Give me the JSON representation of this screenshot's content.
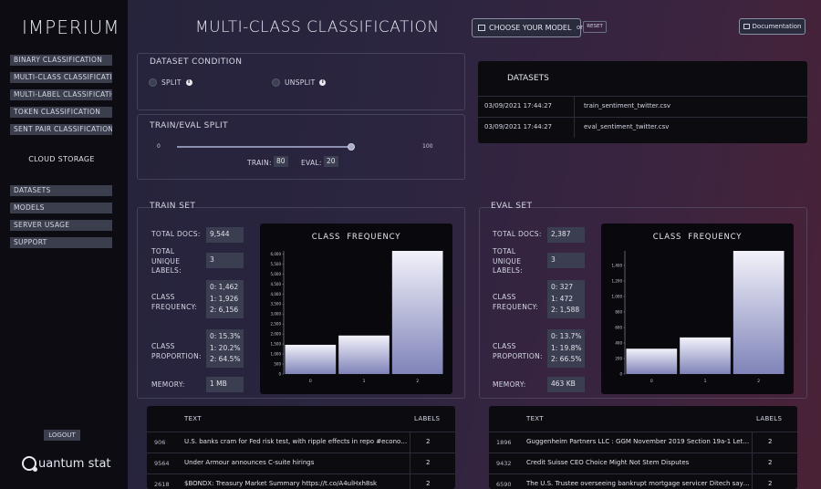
{
  "sidebar": {
    "brand": "IMPERIUM",
    "tasks": [
      "BINARY CLASSIFICATION",
      "MULTI-CLASS CLASSIFICATION",
      "MULTI-LABEL CLASSIFICATION",
      "TOKEN CLASSIFICATION",
      "SENT PAIR CLASSIFICATION"
    ],
    "cloud_storage": "CLOUD STORAGE",
    "storage_items": [
      "DATASETS",
      "MODELS",
      "SERVER USAGE",
      "SUPPORT"
    ],
    "logout": "LOGOUT",
    "logo_text": "uantum stat"
  },
  "header": {
    "title": "MULTI-CLASS CLASSIFICATION",
    "choose_model": "CHOOSE YOUR MODEL",
    "or": "or",
    "reset": "RESET",
    "documentation": "Documentation"
  },
  "dataset_condition": {
    "title": "DATASET CONDITION",
    "split": "SPLIT",
    "unsplit": "UNSPLIT"
  },
  "train_eval_split": {
    "title": "TRAIN/EVAL SPLIT",
    "min": "0",
    "max": "100",
    "value": 80,
    "train_label": "TRAIN:",
    "train_value": "80",
    "eval_label": "EVAL:",
    "eval_value": "20"
  },
  "datasets": {
    "title": "DATASETS",
    "rows": [
      {
        "date": "03/09/2021 17:44:27",
        "file": "train_sentiment_twitter.csv"
      },
      {
        "date": "03/09/2021 17:44:27",
        "file": "eval_sentiment_twitter.csv"
      }
    ]
  },
  "train_set": {
    "title": "TRAIN SET",
    "total_docs_label": "TOTAL DOCS:",
    "total_docs": "9,544",
    "unique_labels_label": [
      "TOTAL",
      "UNIQUE",
      "LABELS:"
    ],
    "unique_labels": "3",
    "class_freq_label": [
      "CLASS",
      "FREQUENCY:"
    ],
    "class_freq": [
      "0:  1,462",
      "1:  1,926",
      "2:  6,156"
    ],
    "class_prop_label": [
      "CLASS",
      "PROPORTION:"
    ],
    "class_prop": [
      "0:  15.3%",
      "1:  20.2%",
      "2:  64.5%"
    ],
    "memory_label": "MEMORY:",
    "memory": "1 MB",
    "chart_title": "CLASS  FREQUENCY",
    "table": {
      "text_header": "TEXT",
      "labels_header": "LABELS",
      "rows": [
        {
          "idx": "906",
          "text": "U.S. banks cram for Fed risk test, with ripple effects in repo #econom...",
          "label": "2"
        },
        {
          "idx": "9564",
          "text": "Under Armour announces C-suite hirings",
          "label": "2"
        },
        {
          "idx": "2618",
          "text": "$BONDX: Treasury Market Summary https://t.co/A4ulHxh8sk",
          "label": "2"
        }
      ]
    }
  },
  "eval_set": {
    "title": "EVAL SET",
    "total_docs_label": "TOTAL DOCS:",
    "total_docs": "2,387",
    "unique_labels_label": [
      "TOTAL",
      "UNIQUE",
      "LABELS:"
    ],
    "unique_labels": "3",
    "class_freq_label": [
      "CLASS",
      "FREQUENCY:"
    ],
    "class_freq": [
      "0:  327",
      "1:  472",
      "2:  1,588"
    ],
    "class_prop_label": [
      "CLASS",
      "PROPORTION:"
    ],
    "class_prop": [
      "0:  13.7%",
      "1:  19.8%",
      "2:  66.5%"
    ],
    "memory_label": "MEMORY:",
    "memory": "463 KB",
    "chart_title": "CLASS  FREQUENCY",
    "table": {
      "text_header": "TEXT",
      "labels_header": "LABELS",
      "rows": [
        {
          "idx": "1896",
          "text": "Guggenheim Partners LLC : GGM November 2019 Section 19a-1 Letter...",
          "label": "2"
        },
        {
          "idx": "9432",
          "text": "Credit Suisse CEO Choice Might Not Stem Disputes",
          "label": "2"
        },
        {
          "idx": "6590",
          "text": "The U.S. Trustee overseeing bankrupt mortgage servicer Ditech says ...",
          "label": "2"
        }
      ]
    }
  },
  "chart_data": [
    {
      "type": "bar",
      "title": "CLASS  FREQUENCY",
      "categories": [
        "0",
        "1",
        "2"
      ],
      "values": [
        1462,
        1926,
        6156
      ],
      "yticks": [
        "0",
        "500",
        "1,000",
        "1,500",
        "2,000",
        "2,500",
        "3,000",
        "3,500",
        "4,000",
        "4,500",
        "5,000",
        "5,500",
        "6,000"
      ],
      "ylim": [
        0,
        6156
      ],
      "bar_color": "#7f83b8"
    },
    {
      "type": "bar",
      "title": "CLASS  FREQUENCY",
      "categories": [
        "0",
        "1",
        "2"
      ],
      "values": [
        327,
        472,
        1588
      ],
      "yticks": [
        "0",
        "200",
        "400",
        "600",
        "800",
        "1,000",
        "1,200",
        "1,400"
      ],
      "ylim": [
        0,
        1588
      ],
      "bar_color": "#7f83b8"
    }
  ]
}
